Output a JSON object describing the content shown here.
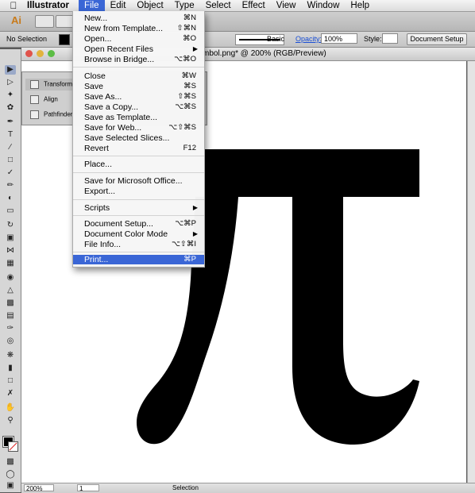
{
  "menubar": {
    "app_name": "Illustrator",
    "menus": [
      "File",
      "Edit",
      "Object",
      "Type",
      "Select",
      "Effect",
      "View",
      "Window",
      "Help"
    ],
    "active_menu": "File"
  },
  "appbar": {
    "logo": "Ai"
  },
  "control_bar": {
    "selection_label": "No Selection",
    "stroke_style": "Basic",
    "opacity_label": "Opacity:",
    "opacity_value": "100%",
    "style_label": "Style:",
    "document_setup": "Document Setup"
  },
  "document": {
    "title": "mbol.png* @ 200% (RGB/Preview)",
    "glyph": "π"
  },
  "panel": {
    "tabs": [
      "Transform",
      "Align",
      "Pathfinder"
    ]
  },
  "statusbar": {
    "zoom": "200%",
    "page": "1",
    "tool": "Selection"
  },
  "file_menu": {
    "items": [
      {
        "label": "New...",
        "shortcut": "⌘N"
      },
      {
        "label": "New from Template...",
        "shortcut": "⇧⌘N"
      },
      {
        "label": "Open...",
        "shortcut": "⌘O"
      },
      {
        "label": "Open Recent Files",
        "shortcut": "▶"
      },
      {
        "label": "Browse in Bridge...",
        "shortcut": "⌥⌘O"
      },
      {
        "label": "Close",
        "shortcut": "⌘W"
      },
      {
        "label": "Save",
        "shortcut": "⌘S"
      },
      {
        "label": "Save As...",
        "shortcut": "⇧⌘S"
      },
      {
        "label": "Save a Copy...",
        "shortcut": "⌥⌘S"
      },
      {
        "label": "Save as Template...",
        "shortcut": ""
      },
      {
        "label": "Save for Web...",
        "shortcut": "⌥⇧⌘S"
      },
      {
        "label": "Save Selected Slices...",
        "shortcut": ""
      },
      {
        "label": "Revert",
        "shortcut": "F12"
      },
      {
        "label": "Place...",
        "shortcut": ""
      },
      {
        "label": "Save for Microsoft Office...",
        "shortcut": ""
      },
      {
        "label": "Export...",
        "shortcut": ""
      },
      {
        "label": "Scripts",
        "shortcut": "▶"
      },
      {
        "label": "Document Setup...",
        "shortcut": "⌥⌘P"
      },
      {
        "label": "Document Color Mode",
        "shortcut": "▶"
      },
      {
        "label": "File Info...",
        "shortcut": "⌥⇧⌘I"
      },
      {
        "label": "Print...",
        "shortcut": "⌘P"
      }
    ],
    "highlighted": "Print..."
  }
}
